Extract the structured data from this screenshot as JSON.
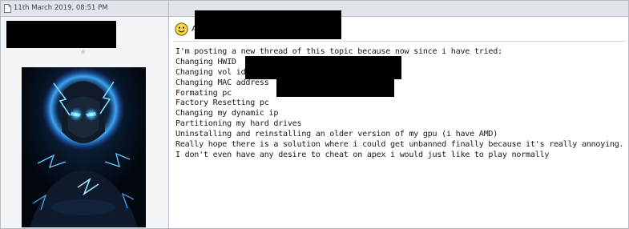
{
  "post": {
    "date": "11th March 2019, 08:51 PM",
    "title_visible_text": "A",
    "lines": [
      "I'm posting a new thread of this topic because now since i have tried:",
      "Changing HWID",
      "Changing vol id",
      "Changing MAC address",
      "Formating pc",
      "Factory Resetting pc",
      "Changing my dynamic ip",
      "Partitioning my hard drives",
      "Uninstalling and reinstalling an older version of my gpu (i have AMD)",
      "Really hope there is a solution where i could get unbanned finally because it's really annoying.",
      "I don't even have any desire to cheat on apex i would just like to play normally"
    ]
  },
  "icons": {
    "header": "post-icon",
    "title": "smiley-icon",
    "rank": "star-icon"
  },
  "colors": {
    "header_bg": "#e1e4e8",
    "border": "#b6bcc4",
    "user_column_bg": "#f4f5f7",
    "redaction": "#000000"
  }
}
